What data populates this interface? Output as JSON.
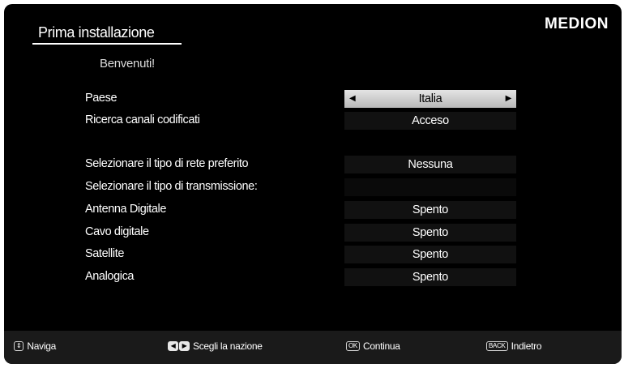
{
  "header": {
    "title": "Prima installazione",
    "brand": "MEDION",
    "welcome": "Benvenuti!"
  },
  "settings": [
    {
      "label": "Paese",
      "value": "Italia",
      "selected": true
    },
    {
      "label": "Ricerca canali codificati",
      "value": "Acceso"
    },
    {
      "label": "Selezionare il tipo di rete preferito",
      "value": "Nessuna"
    },
    {
      "label": "Selezionare il tipo di transmissione:",
      "value": ""
    },
    {
      "label": "Antenna Digitale",
      "value": "Spento"
    },
    {
      "label": "Cavo digitale",
      "value": "Spento"
    },
    {
      "label": "Satellite",
      "value": "Spento"
    },
    {
      "label": "Analogica",
      "value": "Spento"
    }
  ],
  "footer": {
    "navigate": {
      "key": "⇕",
      "label": "Naviga"
    },
    "country": {
      "key_left": "◀",
      "key_right": "▶",
      "label": "Scegli la nazione"
    },
    "continue": {
      "key": "OK",
      "label": "Continua"
    },
    "back": {
      "key": "BACK",
      "label": "Indietro"
    }
  },
  "colors": {
    "background": "#000000",
    "selected_value": "#cfcfcf",
    "value_box": "#111111",
    "text": "#ffffff"
  },
  "icons": {
    "left_arrow": "left-arrow-icon",
    "right_arrow": "right-arrow-icon",
    "updown": "updown-icon"
  }
}
